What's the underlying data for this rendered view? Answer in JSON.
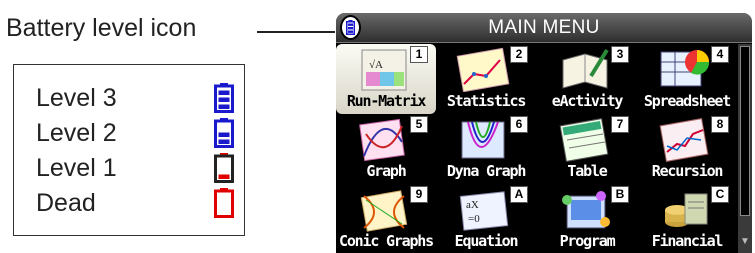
{
  "callout": {
    "label": "Battery level icon"
  },
  "legend": {
    "items": [
      {
        "label": "Level 3",
        "bars": 3,
        "color": "#1a1acc"
      },
      {
        "label": "Level 2",
        "bars": 2,
        "color": "#1a1acc"
      },
      {
        "label": "Level 1",
        "bars": 1,
        "color": "#e00000"
      },
      {
        "label": "Dead",
        "bars": 0,
        "color": "#e00000"
      }
    ]
  },
  "screen": {
    "title": "MAIN MENU",
    "selected": "Run-Matrix",
    "apps": [
      {
        "label": "Run-Matrix",
        "badge": "1",
        "icon": "run-matrix-icon"
      },
      {
        "label": "Statistics",
        "badge": "2",
        "icon": "statistics-icon"
      },
      {
        "label": "eActivity",
        "badge": "3",
        "icon": "eactivity-icon"
      },
      {
        "label": "Spreadsheet",
        "badge": "4",
        "icon": "spreadsheet-icon"
      },
      {
        "label": "Graph",
        "badge": "5",
        "icon": "graph-icon"
      },
      {
        "label": "Dyna Graph",
        "badge": "6",
        "icon": "dyna-graph-icon"
      },
      {
        "label": "Table",
        "badge": "7",
        "icon": "table-icon"
      },
      {
        "label": "Recursion",
        "badge": "8",
        "icon": "recursion-icon"
      },
      {
        "label": "Conic Graphs",
        "badge": "9",
        "icon": "conic-graphs-icon"
      },
      {
        "label": "Equation",
        "badge": "A",
        "icon": "equation-icon"
      },
      {
        "label": "Program",
        "badge": "B",
        "icon": "program-icon"
      },
      {
        "label": "Financial",
        "badge": "C",
        "icon": "financial-icon"
      }
    ]
  }
}
